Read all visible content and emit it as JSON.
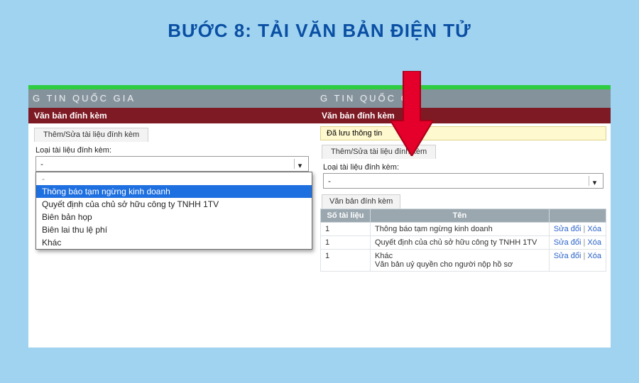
{
  "title": "BƯỚC 8: TẢI VĂN BẢN ĐIỆN TỬ",
  "header_fragment_left": "G TIN QUỐC GIA",
  "header_fragment_right": "G TIN QUỐC GIA",
  "section_title": "Văn bản đính kèm",
  "tab_label": "Thêm/Sửa tài liệu đính kèm",
  "field_label": "Loại tài liệu đính kèm:",
  "saved_message": "Đã lưu thông tin",
  "select_value_left": "-",
  "select_value_right": "-",
  "dropdown_options": {
    "o0": "-",
    "o1": "Thông báo tạm ngừng kinh doanh",
    "o2": "Quyết định của chủ sở hữu công ty TNHH 1TV",
    "o3": "Biên bản họp",
    "o4": "Biên lai thu lệ phí",
    "o5": "Khác"
  },
  "dropdown_highlighted_index": 1,
  "attach_subhead": "Văn bản đính kèm",
  "table": {
    "col_num": "Số tài liệu",
    "col_name": "Tên",
    "action_edit": "Sửa đổi",
    "action_delete": "Xóa",
    "rows": {
      "r0": {
        "num": "1",
        "name": "Thông báo tạm ngừng kinh doanh"
      },
      "r1": {
        "num": "1",
        "name": "Quyết định của chủ sở hữu công ty TNHH 1TV"
      },
      "r2": {
        "num": "1",
        "name": "Khác\nVăn bản uỷ quyền cho người nộp hồ sơ"
      }
    }
  }
}
